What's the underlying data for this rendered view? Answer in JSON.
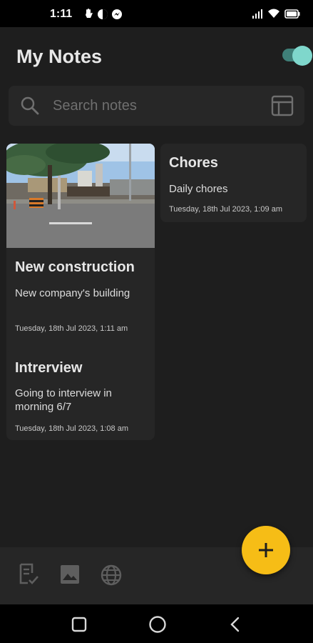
{
  "status_bar": {
    "time": "1:11",
    "icons": [
      "wifi-icon",
      "signal-icon",
      "battery-icon"
    ]
  },
  "header": {
    "title": "My Notes",
    "theme_toggle": "on"
  },
  "search": {
    "placeholder": "Search notes"
  },
  "notes": [
    {
      "title": "New construction",
      "body": "New company's building",
      "date": "Tuesday, 18th Jul 2023, 1:11 am",
      "has_image": true
    },
    {
      "title": "Chores",
      "body": "Daily chores",
      "date": "Tuesday, 18th Jul 2023, 1:09 am",
      "has_image": false
    },
    {
      "title": "Intrerview",
      "body": "Going to interview in morning 6/7",
      "date": "Tuesday, 18th Jul 2023, 1:08 am",
      "has_image": false
    }
  ],
  "bottom_bar": {
    "icons": [
      "checklist-note-icon",
      "image-icon",
      "web-link-icon"
    ]
  },
  "fab": {
    "icon": "add-icon",
    "color": "#f6bd16"
  },
  "nav_bar": {
    "icons": [
      "recents-icon",
      "home-icon",
      "back-icon"
    ]
  },
  "colors": {
    "background": "#1e1e1e",
    "card": "#262626",
    "accent_teal": "#7fd7cc",
    "accent_yellow": "#f6bd16"
  }
}
